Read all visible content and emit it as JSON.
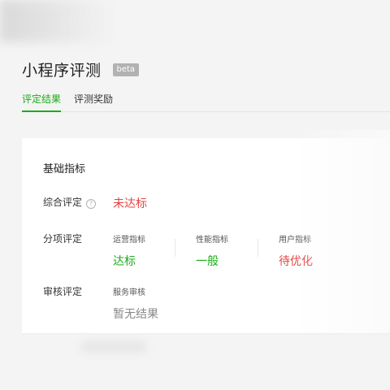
{
  "header": {
    "title": "小程序评测",
    "badge": "beta"
  },
  "tabs": [
    {
      "label": "评定结果",
      "active": true
    },
    {
      "label": "评测奖励",
      "active": false
    }
  ],
  "card": {
    "section_title": "基础指标",
    "overall": {
      "label": "综合评定",
      "help_icon": "question-circle-icon",
      "value": "未达标",
      "value_color": "#e64340"
    },
    "sub": {
      "label": "分项评定",
      "metrics": [
        {
          "label": "运营指标",
          "value": "达标",
          "color": "#1aad19"
        },
        {
          "label": "性能指标",
          "value": "一般",
          "color": "#1aad19"
        },
        {
          "label": "用户指标",
          "value": "待优化",
          "color": "#e64340"
        }
      ]
    },
    "review": {
      "label": "审核评定",
      "metric_label": "服务审核",
      "value": "暂无结果"
    }
  },
  "colors": {
    "accent": "#1aad19",
    "warning": "#e64340",
    "badge_bg": "#b2b2b2"
  }
}
